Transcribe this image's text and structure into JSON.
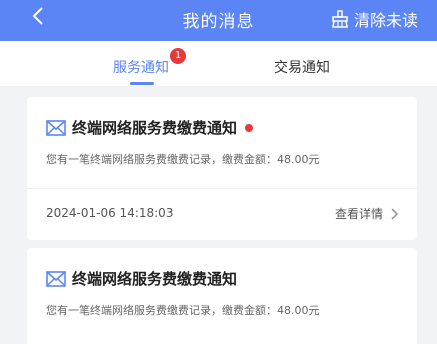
{
  "header": {
    "title": "我的消息",
    "clear_label": "清除未读",
    "back_icon": "chevron-left-icon",
    "clear_icon": "broom-icon"
  },
  "tabs": [
    {
      "label": "服务通知",
      "badge": "1",
      "active": true
    },
    {
      "label": "交易通知",
      "active": false
    }
  ],
  "messages": [
    {
      "title": "终端网络服务费缴费通知",
      "unread": true,
      "description": "您有一笔终端网络服务费缴费记录，缴费金额：48.00元",
      "time": "2024-01-06 14:18:03",
      "action_label": "查看详情"
    },
    {
      "title": "终端网络服务费缴费通知",
      "unread": false,
      "description": "您有一笔终端网络服务费缴费记录，缴费金额：48.00元"
    }
  ],
  "colors": {
    "accent": "#5b85f4",
    "badge": "#e63a3a",
    "background": "#f2f3f6"
  }
}
